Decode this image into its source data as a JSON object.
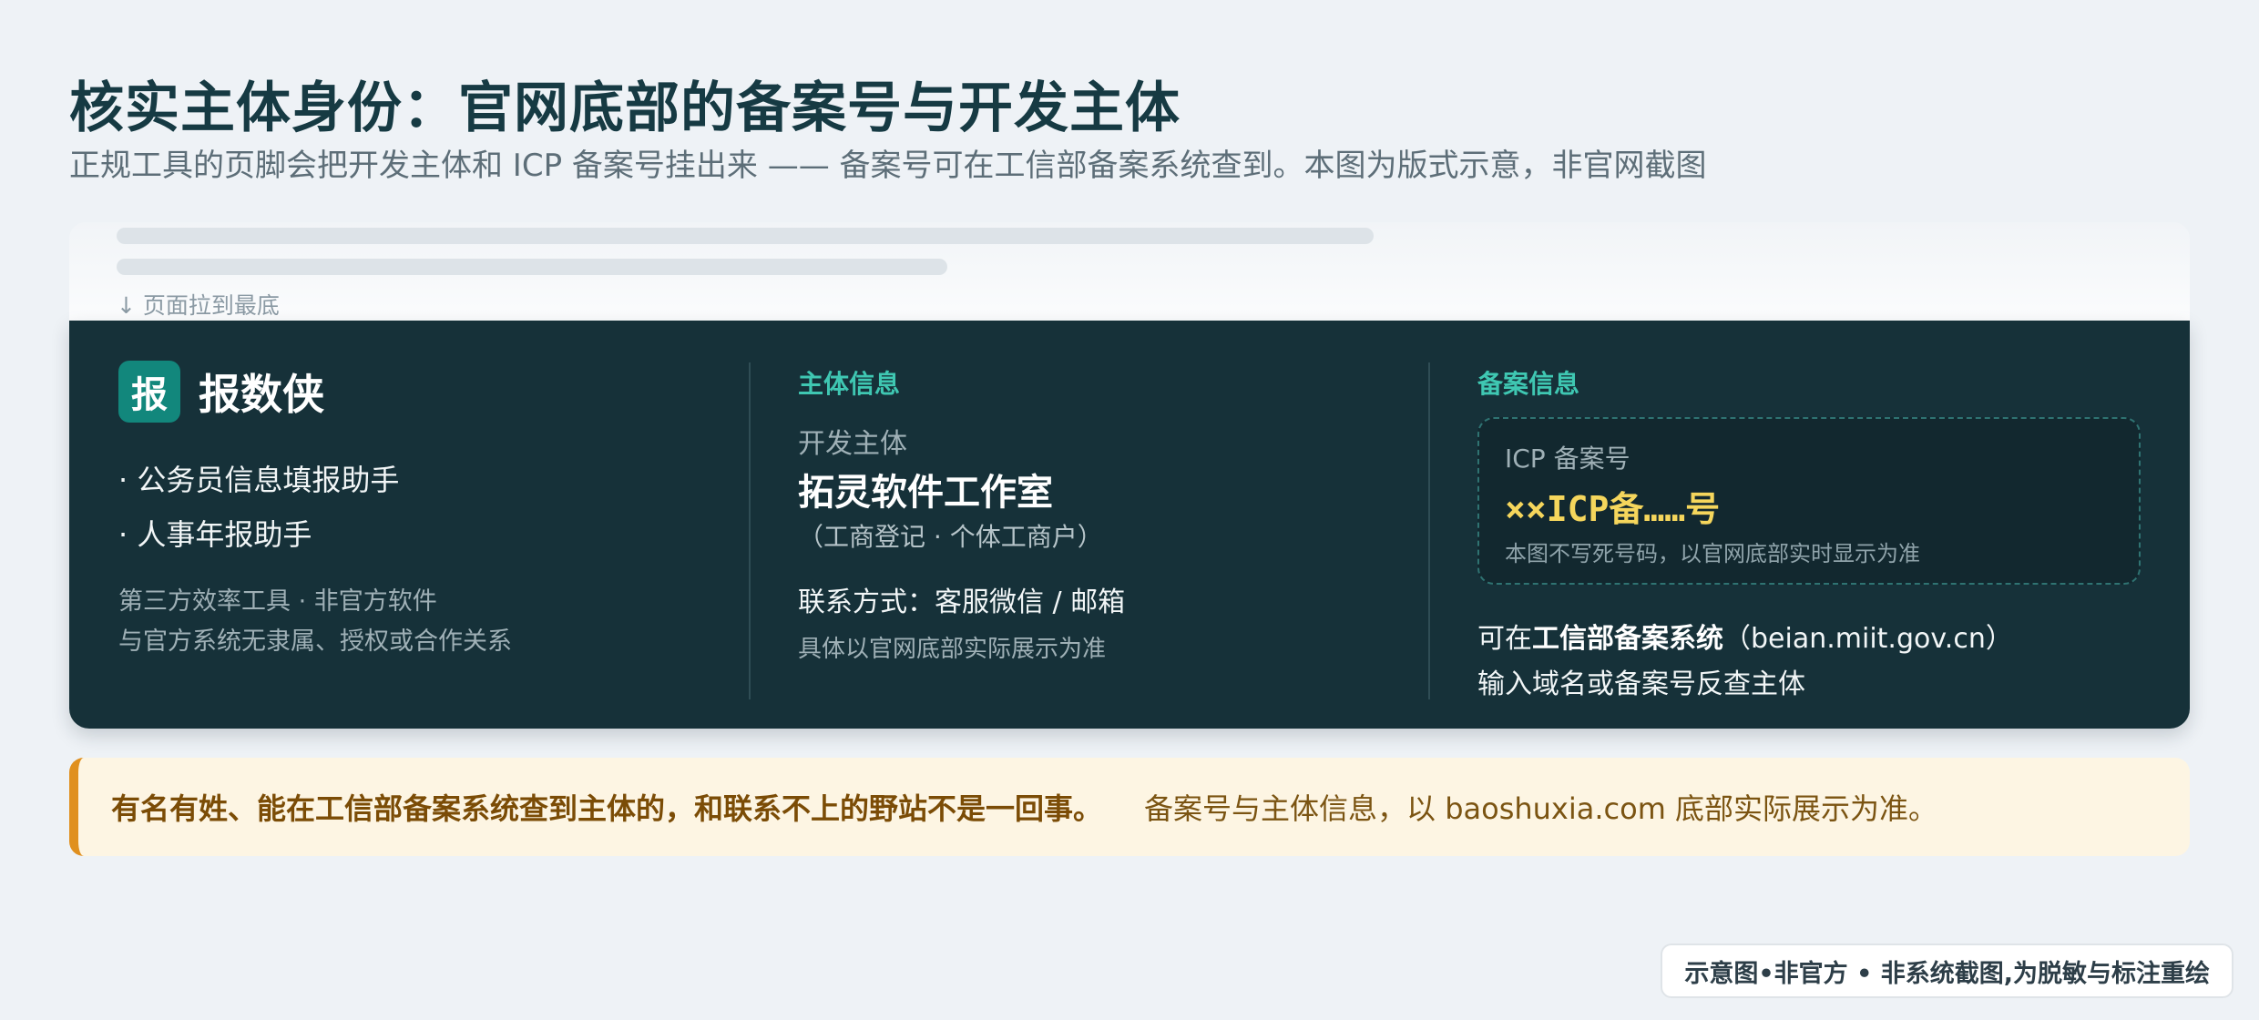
{
  "header": {
    "title": "核实主体身份：官网底部的备案号与开发主体",
    "subtitle": "正规工具的页脚会把开发主体和 ICP 备案号挂出来 —— 备案号可在工信部备案系统查到。本图为版式示意，非官网截图"
  },
  "mock_page": {
    "scroll_hint": "↓ 页面拉到最底"
  },
  "footer": {
    "brand": {
      "logo_char": "报",
      "name": "报数侠",
      "products": [
        "· 公务员信息填报助手",
        "· 人事年报助手"
      ],
      "notes": [
        "第三方效率工具 · 非官方软件",
        "与官方系统无隶属、授权或合作关系"
      ]
    },
    "entity": {
      "section_title": "主体信息",
      "label": "开发主体",
      "name": "拓灵软件工作室",
      "registration": "（工商登记 · 个体工商户）",
      "contact": "联系方式：客服微信 / 邮箱",
      "note": "具体以官网底部实际展示为准"
    },
    "filing": {
      "section_title": "备案信息",
      "icp_label": "ICP 备案号",
      "icp_value": "××ICP备……号",
      "icp_hint": "本图不写死号码，以官网底部实时显示为准",
      "verify_prefix": "可在",
      "verify_system": "工信部备案系统",
      "verify_url": "（beian.miit.gov.cn）",
      "verify_line2": "输入域名或备案号反查主体"
    }
  },
  "callout": {
    "strong": "有名有姓、能在工信部备案系统查到主体的，和联系不上的野站不是一回事。",
    "rest": "备案号与主体信息，以 baoshuxia.com 底部实际展示为准。"
  },
  "disclaimer": "示意图•非官方 • 非系统截图,为脱敏与标注重绘",
  "colors": {
    "footer_bg": "#163139",
    "accent_teal": "#3fc7b2",
    "icp_yellow": "#f5d65c",
    "callout_bar": "#e0901f"
  }
}
